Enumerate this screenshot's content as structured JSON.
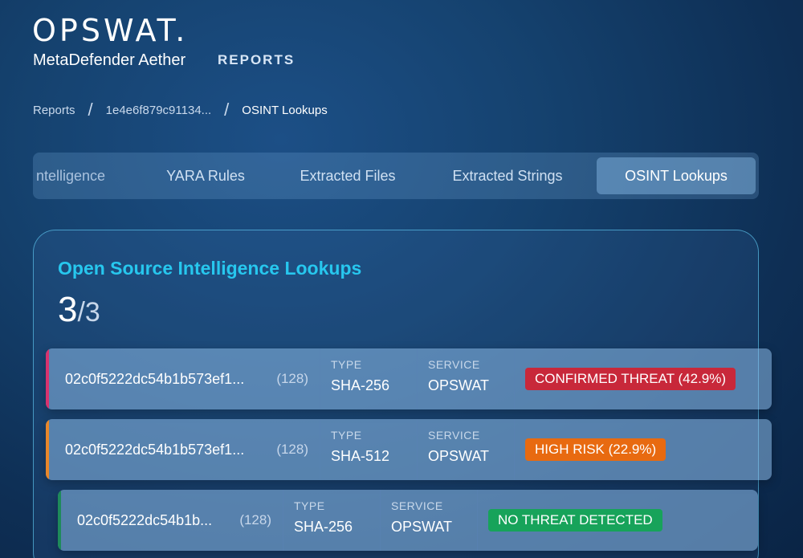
{
  "header": {
    "logo": "OPSWAT.",
    "product": "MetaDefender Aether",
    "section": "REPORTS"
  },
  "breadcrumb": {
    "items": [
      "Reports",
      "1e4e6f879c91134...",
      "OSINT Lookups"
    ],
    "separator": "/"
  },
  "tabs": {
    "items": [
      {
        "label": "ntelligence",
        "active": false
      },
      {
        "label": "YARA Rules",
        "active": false
      },
      {
        "label": "Extracted Files",
        "active": false
      },
      {
        "label": "Extracted Strings",
        "active": false
      },
      {
        "label": "OSINT Lookups",
        "active": true
      }
    ]
  },
  "card": {
    "title": "Open Source Intelligence Lookups",
    "count": "3",
    "total": "/3"
  },
  "labels": {
    "type": "TYPE",
    "service": "SERVICE"
  },
  "rows": [
    {
      "hash": "02c0f5222dc54b1b573ef1...",
      "length": "(128)",
      "type": "SHA-256",
      "service": "OPSWAT",
      "badge": "CONFIRMED THREAT (42.9%)",
      "badge_color": "#c8283a",
      "accent_color": "#d8326e"
    },
    {
      "hash": "02c0f5222dc54b1b573ef1...",
      "length": "(128)",
      "type": "SHA-512",
      "service": "OPSWAT",
      "badge": "HIGH RISK (22.9%)",
      "badge_color": "#e86a10",
      "accent_color": "#e8872a"
    },
    {
      "hash": "02c0f5222dc54b1b...",
      "length": "(128)",
      "type": "SHA-256",
      "service": "OPSWAT",
      "badge": "NO THREAT DETECTED",
      "badge_color": "#17a35a",
      "accent_color": "#1e8a5a"
    }
  ]
}
